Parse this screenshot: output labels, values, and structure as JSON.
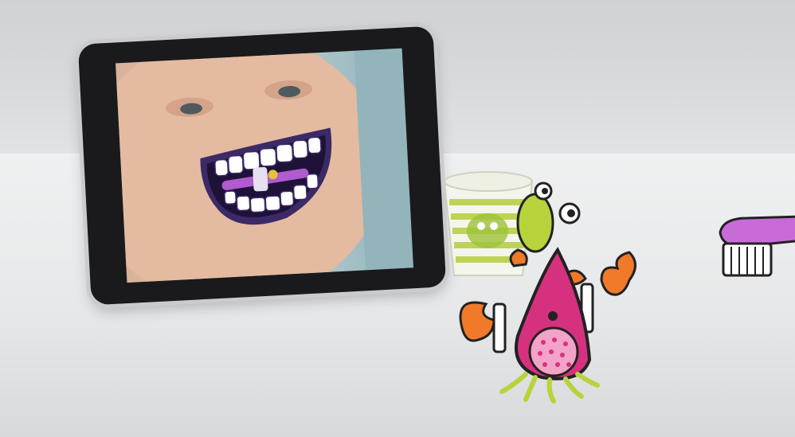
{
  "scene": {
    "description_tags": [
      "tablet-showing-child-with-cartoon-mouth",
      "paper-cup",
      "cartoon-monster",
      "cartoon-toothbrush"
    ]
  },
  "colors": {
    "monster_pink": "#d6317f",
    "monster_orange": "#f07a2a",
    "monster_legs": "#b7d33b",
    "lips_purple": "#4a2a7a",
    "cup_green": "#b8d046",
    "brush_purple": "#c86ad8"
  }
}
